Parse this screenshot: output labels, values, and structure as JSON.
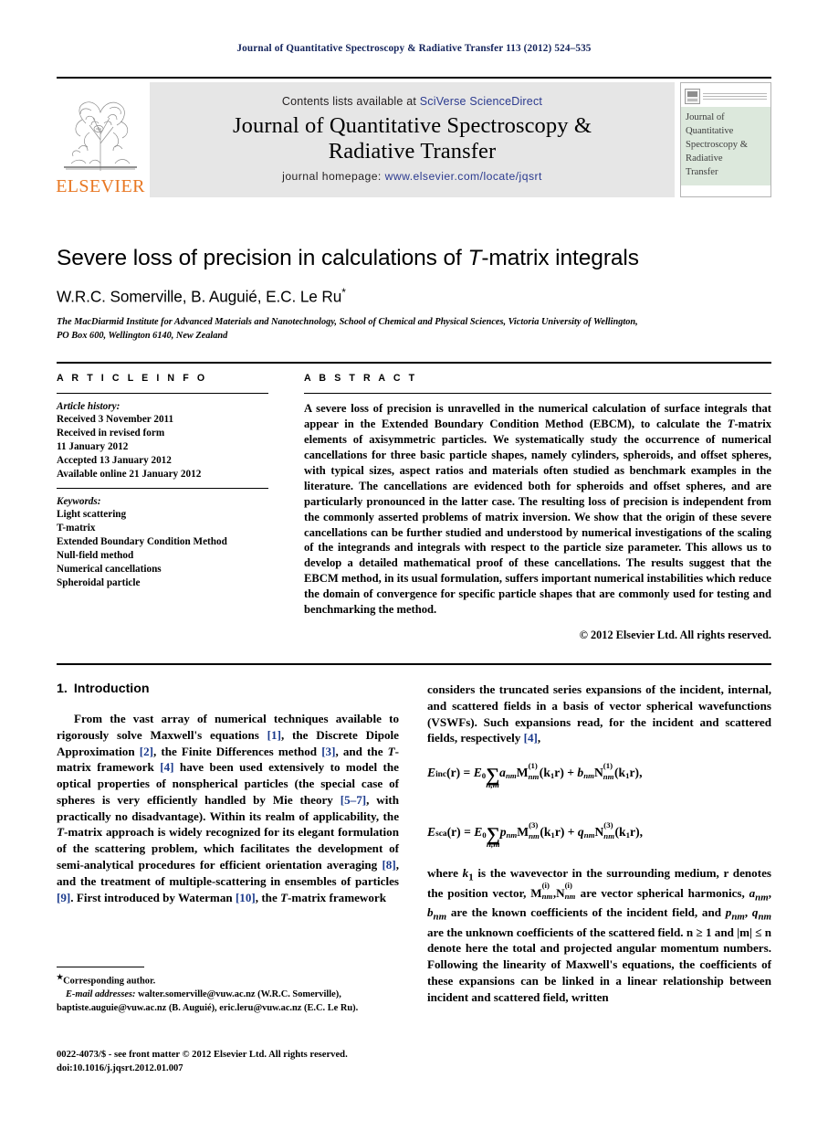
{
  "running_head": "Journal of Quantitative Spectroscopy & Radiative Transfer 113 (2012) 524–535",
  "masthead": {
    "contents_prefix": "Contents lists available at ",
    "sciencedirect": "SciVerse ScienceDirect",
    "journal_title_line1": "Journal of Quantitative Spectroscopy &",
    "journal_title_line2": "Radiative Transfer",
    "homepage_prefix": "journal homepage: ",
    "homepage_url": "www.elsevier.com/locate/jqsrt",
    "publisher_wordmark": "ELSEVIER",
    "link_color": "#2b3a8f",
    "band_color": "#e6e6e6",
    "elsevier_orange": "#e87722",
    "cover": {
      "line1": "Journal of",
      "line2": "Quantitative",
      "line3": "Spectroscopy &",
      "line4": "Radiative",
      "line5": "Transfer",
      "bg_color": "#dce8dc"
    }
  },
  "title": {
    "before_italic": "Severe loss of precision in calculations of ",
    "italic": "T",
    "after_italic": "-matrix integrals"
  },
  "authors": "W.R.C. Somerville, B. Auguié, E.C. Le Ru",
  "author_footnote_marker": "*",
  "affiliation_line1": "The MacDiarmid Institute for Advanced Materials and Nanotechnology, School of Chemical and Physical Sciences, Victoria University of Wellington,",
  "affiliation_line2": "PO Box 600, Wellington 6140, New Zealand",
  "article_info": {
    "heading": "A R T I C L E   I N F O",
    "history_label": "Article history:",
    "history": [
      "Received 3 November 2011",
      "Received in revised form",
      "11 January 2012",
      "Accepted 13 January 2012",
      "Available online 21 January 2012"
    ],
    "keywords_label": "Keywords:",
    "keywords": [
      "Light scattering",
      "T-matrix",
      "Extended Boundary Condition Method",
      "Null-field method",
      "Numerical cancellations",
      "Spheroidal particle"
    ]
  },
  "abstract": {
    "heading": "A B S T R A C T",
    "part1": "A severe loss of precision is unravelled in the numerical calculation of surface integrals that appear in the Extended Boundary Condition Method (EBCM), to calculate the ",
    "italic_T": "T",
    "part2": "-matrix elements of axisymmetric particles. We systematically study the occurrence of numerical cancellations for three basic particle shapes, namely cylinders, spheroids, and offset spheres, with typical sizes, aspect ratios and materials often studied as benchmark examples in the literature. The cancellations are evidenced both for spheroids and offset spheres, and are particularly pronounced in the latter case. The resulting loss of precision is independent from the commonly asserted problems of matrix inversion. We show that the origin of these severe cancellations can be further studied and understood by numerical investigations of the scaling of the integrands and integrals with respect to the particle size parameter. This allows us to develop a detailed mathematical proof of these cancellations. The results suggest that the EBCM method, in its usual formulation, suffers important numerical instabilities which reduce the domain of convergence for specific particle shapes that are commonly used for testing and benchmarking the method.",
    "copyright": "© 2012 Elsevier Ltd. All rights reserved."
  },
  "section": {
    "number": "1.",
    "title": "Introduction"
  },
  "body": {
    "left_par1": {
      "s1": "From the vast array of numerical techniques available to rigorously solve Maxwell's equations ",
      "r1": "[1]",
      "s2": ", the Discrete Dipole Approximation ",
      "r2": "[2]",
      "s3": ", the Finite Differences method ",
      "r3": "[3]",
      "s4": ", and the ",
      "i1": "T",
      "s5": "-matrix framework ",
      "r4": "[4]",
      "s6": " have been used extensively to model the optical properties of nonspherical particles (the special case of spheres is very efficiently handled by Mie theory ",
      "r5": "[5–7]",
      "s7": ", with practically no disadvantage). Within its realm of applicability, the ",
      "i2": "T",
      "s8": "-matrix approach is widely recognized for its elegant formulation of the scattering problem, which facilitates the development of semi-analytical procedures for efficient orientation averaging ",
      "r6": "[8]",
      "s9": ", and the treatment of multiple-scattering in ensembles of particles ",
      "r7": "[9]",
      "s10": ". First introduced by Waterman ",
      "r8": "[10]",
      "s11": ", the ",
      "i3": "T",
      "s12": "-matrix framework"
    },
    "right_par1": {
      "s1": "considers the truncated series expansions of the incident, internal, and scattered fields in a basis of vector spherical wavefunctions (VSWFs). Such expansions read, for the incident and scattered fields, respectively ",
      "r1": "[4]",
      "s2": ","
    },
    "right_par2": {
      "s1": "where ",
      "i1": "k",
      "sub1": "1",
      "s2": " is the wavevector in the surrounding medium, ",
      "b1": "r",
      "s3": " denotes the position vector, ",
      "m1": "M",
      "m1sub": "nm",
      "m1sup": "(i)",
      "s4": ",",
      "m2": "N",
      "m2sub": "nm",
      "m2sup": "(i)",
      "s5": " are vector spherical harmonics, ",
      "i2": "a",
      "i2sub": "nm",
      "s6": ", ",
      "i3": "b",
      "i3sub": "nm",
      "s7": " are the known coefficients of the incident field, and ",
      "i4": "p",
      "i4sub": "nm",
      "s8": ", ",
      "i5": "q",
      "i5sub": "nm",
      "s9": " are the unknown coefficients of the scattered field. n ≥ 1 and |m| ≤ n denote here the total and projected angular momentum numbers. Following the linearity of Maxwell's equations, the coefficients of these expansions can be linked in a linear relationship between incident and scattered field, written"
    },
    "equation1": {
      "lhs": "E",
      "lhs_sub": "inc",
      "lhs_arg": "(r)",
      "eq": " = ",
      "E0": "E",
      "E0_sub": "0",
      "sum_sub": "n,m",
      "coef1": "a",
      "coef1_sub": "nm",
      "vec1": "M",
      "vec1_sub": "nm",
      "vec1_sup": "(1)",
      "arg1": "(k",
      "arg1_sub": "1",
      "arg1_end": "r)",
      "plus": " + ",
      "coef2": "b",
      "coef2_sub": "nm",
      "vec2": "N",
      "vec2_sub": "nm",
      "vec2_sup": "(1)",
      "arg2": "(k",
      "arg2_sub": "1",
      "arg2_end": "r),"
    },
    "equation2": {
      "lhs": "E",
      "lhs_sub": "sca",
      "lhs_arg": "(r)",
      "eq": " = ",
      "E0": "E",
      "E0_sub": "0",
      "sum_sub": "n,m",
      "coef1": "p",
      "coef1_sub": "nm",
      "vec1": "M",
      "vec1_sub": "nm",
      "vec1_sup": "(3)",
      "arg1": "(k",
      "arg1_sub": "1",
      "arg1_end": "r)",
      "plus": " + ",
      "coef2": "q",
      "coef2_sub": "nm",
      "vec2": "N",
      "vec2_sub": "nm",
      "vec2_sup": "(3)",
      "arg2": "(k",
      "arg2_sub": "1",
      "arg2_end": "r),"
    }
  },
  "footnote": {
    "corresponding": "Corresponding author.",
    "email_label": "E-mail addresses:",
    "emails": " walter.somerville@vuw.ac.nz (W.R.C. Somerville), baptiste.auguie@vuw.ac.nz (B. Auguié), eric.leru@vuw.ac.nz (E.C. Le Ru)."
  },
  "frontmatter": {
    "line1": "0022-4073/$ - see front matter © 2012 Elsevier Ltd. All rights reserved.",
    "line2": "doi:10.1016/j.jqsrt.2012.01.007"
  }
}
